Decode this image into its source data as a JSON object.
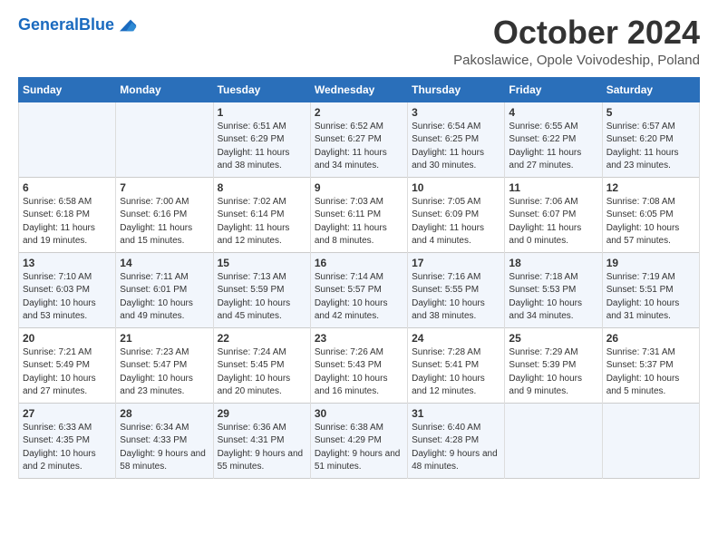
{
  "header": {
    "logo_general": "General",
    "logo_blue": "Blue",
    "month_title": "October 2024",
    "location": "Pakoslawice, Opole Voivodeship, Poland"
  },
  "days_of_week": [
    "Sunday",
    "Monday",
    "Tuesday",
    "Wednesday",
    "Thursday",
    "Friday",
    "Saturday"
  ],
  "weeks": [
    [
      {
        "day": "",
        "info": ""
      },
      {
        "day": "",
        "info": ""
      },
      {
        "day": "1",
        "info": "Sunrise: 6:51 AM\nSunset: 6:29 PM\nDaylight: 11 hours and 38 minutes."
      },
      {
        "day": "2",
        "info": "Sunrise: 6:52 AM\nSunset: 6:27 PM\nDaylight: 11 hours and 34 minutes."
      },
      {
        "day": "3",
        "info": "Sunrise: 6:54 AM\nSunset: 6:25 PM\nDaylight: 11 hours and 30 minutes."
      },
      {
        "day": "4",
        "info": "Sunrise: 6:55 AM\nSunset: 6:22 PM\nDaylight: 11 hours and 27 minutes."
      },
      {
        "day": "5",
        "info": "Sunrise: 6:57 AM\nSunset: 6:20 PM\nDaylight: 11 hours and 23 minutes."
      }
    ],
    [
      {
        "day": "6",
        "info": "Sunrise: 6:58 AM\nSunset: 6:18 PM\nDaylight: 11 hours and 19 minutes."
      },
      {
        "day": "7",
        "info": "Sunrise: 7:00 AM\nSunset: 6:16 PM\nDaylight: 11 hours and 15 minutes."
      },
      {
        "day": "8",
        "info": "Sunrise: 7:02 AM\nSunset: 6:14 PM\nDaylight: 11 hours and 12 minutes."
      },
      {
        "day": "9",
        "info": "Sunrise: 7:03 AM\nSunset: 6:11 PM\nDaylight: 11 hours and 8 minutes."
      },
      {
        "day": "10",
        "info": "Sunrise: 7:05 AM\nSunset: 6:09 PM\nDaylight: 11 hours and 4 minutes."
      },
      {
        "day": "11",
        "info": "Sunrise: 7:06 AM\nSunset: 6:07 PM\nDaylight: 11 hours and 0 minutes."
      },
      {
        "day": "12",
        "info": "Sunrise: 7:08 AM\nSunset: 6:05 PM\nDaylight: 10 hours and 57 minutes."
      }
    ],
    [
      {
        "day": "13",
        "info": "Sunrise: 7:10 AM\nSunset: 6:03 PM\nDaylight: 10 hours and 53 minutes."
      },
      {
        "day": "14",
        "info": "Sunrise: 7:11 AM\nSunset: 6:01 PM\nDaylight: 10 hours and 49 minutes."
      },
      {
        "day": "15",
        "info": "Sunrise: 7:13 AM\nSunset: 5:59 PM\nDaylight: 10 hours and 45 minutes."
      },
      {
        "day": "16",
        "info": "Sunrise: 7:14 AM\nSunset: 5:57 PM\nDaylight: 10 hours and 42 minutes."
      },
      {
        "day": "17",
        "info": "Sunrise: 7:16 AM\nSunset: 5:55 PM\nDaylight: 10 hours and 38 minutes."
      },
      {
        "day": "18",
        "info": "Sunrise: 7:18 AM\nSunset: 5:53 PM\nDaylight: 10 hours and 34 minutes."
      },
      {
        "day": "19",
        "info": "Sunrise: 7:19 AM\nSunset: 5:51 PM\nDaylight: 10 hours and 31 minutes."
      }
    ],
    [
      {
        "day": "20",
        "info": "Sunrise: 7:21 AM\nSunset: 5:49 PM\nDaylight: 10 hours and 27 minutes."
      },
      {
        "day": "21",
        "info": "Sunrise: 7:23 AM\nSunset: 5:47 PM\nDaylight: 10 hours and 23 minutes."
      },
      {
        "day": "22",
        "info": "Sunrise: 7:24 AM\nSunset: 5:45 PM\nDaylight: 10 hours and 20 minutes."
      },
      {
        "day": "23",
        "info": "Sunrise: 7:26 AM\nSunset: 5:43 PM\nDaylight: 10 hours and 16 minutes."
      },
      {
        "day": "24",
        "info": "Sunrise: 7:28 AM\nSunset: 5:41 PM\nDaylight: 10 hours and 12 minutes."
      },
      {
        "day": "25",
        "info": "Sunrise: 7:29 AM\nSunset: 5:39 PM\nDaylight: 10 hours and 9 minutes."
      },
      {
        "day": "26",
        "info": "Sunrise: 7:31 AM\nSunset: 5:37 PM\nDaylight: 10 hours and 5 minutes."
      }
    ],
    [
      {
        "day": "27",
        "info": "Sunrise: 6:33 AM\nSunset: 4:35 PM\nDaylight: 10 hours and 2 minutes."
      },
      {
        "day": "28",
        "info": "Sunrise: 6:34 AM\nSunset: 4:33 PM\nDaylight: 9 hours and 58 minutes."
      },
      {
        "day": "29",
        "info": "Sunrise: 6:36 AM\nSunset: 4:31 PM\nDaylight: 9 hours and 55 minutes."
      },
      {
        "day": "30",
        "info": "Sunrise: 6:38 AM\nSunset: 4:29 PM\nDaylight: 9 hours and 51 minutes."
      },
      {
        "day": "31",
        "info": "Sunrise: 6:40 AM\nSunset: 4:28 PM\nDaylight: 9 hours and 48 minutes."
      },
      {
        "day": "",
        "info": ""
      },
      {
        "day": "",
        "info": ""
      }
    ]
  ]
}
